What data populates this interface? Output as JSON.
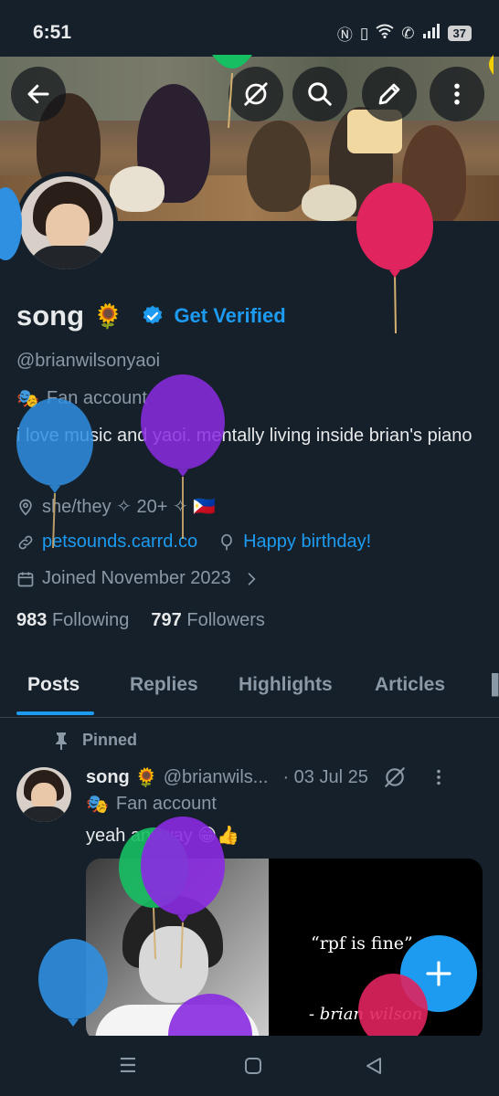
{
  "status_bar": {
    "time": "6:51",
    "icons": [
      "nfc-icon",
      "vibrate-icon",
      "wifi-icon",
      "wifi-calling-icon",
      "signal-icon"
    ],
    "battery": "37"
  },
  "header_actions": [
    "back-arrow-icon",
    "grok-icon",
    "search-icon",
    "edit-icon",
    "more-vertical-icon"
  ],
  "profile": {
    "display_name": "song",
    "name_emoji": "🌻",
    "get_verified": "Get Verified",
    "handle": "@brianwilsonyaoi",
    "label_icon": "🎭",
    "label": "Fan account",
    "bio": "i love music and yaoi. mentally living inside brian's piano",
    "pronouns_line": "she/they ✧ 20+ ✧ 🇵🇭",
    "website": "petsounds.carrd.co",
    "birthday": "Happy birthday!",
    "joined": "Joined November 2023",
    "following_count": "983",
    "following_label": "Following",
    "followers_count": "797",
    "followers_label": "Followers"
  },
  "tabs": [
    "Posts",
    "Replies",
    "Highlights",
    "Articles"
  ],
  "active_tab": "Posts",
  "pinned_post": {
    "pinned_label": "Pinned",
    "author_name": "song",
    "author_emoji": "🌻",
    "author_handle": "@brianwils...",
    "date": "· 03 Jul 25",
    "label_icon": "🎭",
    "label": "Fan account",
    "text": "yeah anyway 😁👍",
    "media_quote": "“rpf is fine”",
    "media_author": "- brian wilson"
  },
  "colors": {
    "background": "#15202b",
    "accent": "#1d9bf0",
    "muted_text": "#8b98a5",
    "primary_text": "#e7e9ea",
    "balloon_blue": "#2f8fe0",
    "balloon_purple": "#8a2be2",
    "balloon_red": "#e0245e",
    "balloon_green": "#17bf63"
  }
}
